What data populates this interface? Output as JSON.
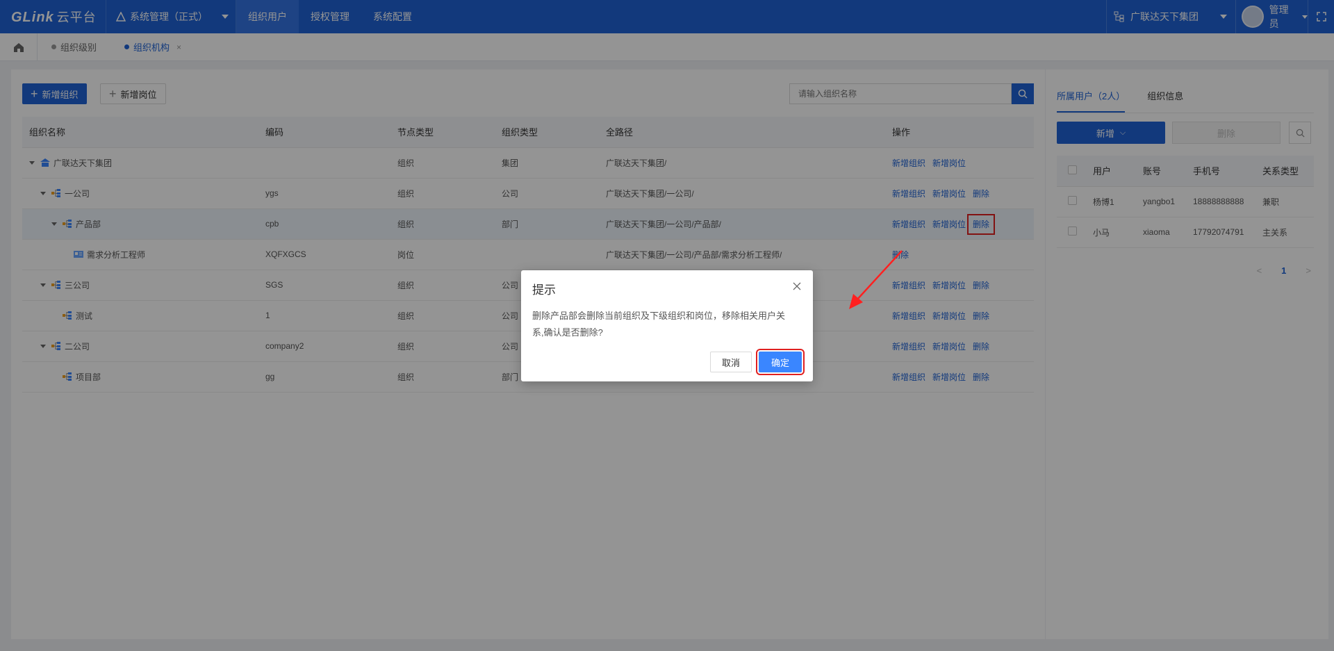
{
  "topbar": {
    "logo_text": "GLink",
    "logo_cn": "云平台",
    "system_select": "系统管理（正式）",
    "nav": [
      "组织用户",
      "授权管理",
      "系统配置"
    ],
    "org_select": "广联达天下集团",
    "user_name": "管理员"
  },
  "tabs": {
    "items": [
      "组织级别",
      "组织机构"
    ],
    "close": "×"
  },
  "toolbar": {
    "add_org": "新增组织",
    "add_post": "新增岗位",
    "search_placeholder": "请输入组织名称"
  },
  "table": {
    "headers": [
      "组织名称",
      "编码",
      "节点类型",
      "组织类型",
      "全路径",
      "操作"
    ],
    "rows": [
      {
        "name": "广联达天下集团",
        "code": "",
        "node": "组织",
        "type": "集团",
        "path": "广联达天下集团/",
        "ops": [
          "新增组织",
          "新增岗位"
        ]
      },
      {
        "name": "一公司",
        "code": "ygs",
        "node": "组织",
        "type": "公司",
        "path": "广联达天下集团/一公司/",
        "ops": [
          "新增组织",
          "新增岗位",
          "删除"
        ]
      },
      {
        "name": "产品部",
        "code": "cpb",
        "node": "组织",
        "type": "部门",
        "path": "广联达天下集团/一公司/产品部/",
        "ops": [
          "新增组织",
          "新增岗位",
          "删除"
        ]
      },
      {
        "name": "需求分析工程师",
        "code": "XQFXGCS",
        "node": "岗位",
        "type": "",
        "path": "广联达天下集团/一公司/产品部/需求分析工程师/",
        "ops": [
          "删除"
        ]
      },
      {
        "name": "三公司",
        "code": "SGS",
        "node": "组织",
        "type": "公司",
        "path": "",
        "ops": [
          "新增组织",
          "新增岗位",
          "删除"
        ]
      },
      {
        "name": "测试",
        "code": "1",
        "node": "组织",
        "type": "公司",
        "path": "",
        "ops": [
          "新增组织",
          "新增岗位",
          "删除"
        ]
      },
      {
        "name": "二公司",
        "code": "company2",
        "node": "组织",
        "type": "公司",
        "path": "",
        "ops": [
          "新增组织",
          "新增岗位",
          "删除"
        ]
      },
      {
        "name": "项目部",
        "code": "gg",
        "node": "组织",
        "type": "部门",
        "path": "",
        "ops": [
          "新增组织",
          "新增岗位",
          "删除"
        ]
      }
    ]
  },
  "side": {
    "tabs": [
      "所属用户（2人）",
      "组织信息"
    ],
    "add": "新增",
    "delete": "删除",
    "headers": [
      "用户",
      "账号",
      "手机号",
      "关系类型"
    ],
    "rows": [
      {
        "user": "杨博1",
        "account": "yangbo1",
        "phone": "18888888888",
        "relation": "兼职"
      },
      {
        "user": "小马",
        "account": "xiaoma",
        "phone": "17792074791",
        "relation": "主关系"
      }
    ],
    "page": "1",
    "prev": "<",
    "next": ">"
  },
  "dialog": {
    "title": "提示",
    "message": "删除产品部会删除当前组织及下级组织和岗位，移除相关用户关系,确认是否删除?",
    "cancel": "取消",
    "ok": "确定"
  },
  "colors": {
    "primary": "#1f63d6",
    "highlight": "#e02020"
  }
}
